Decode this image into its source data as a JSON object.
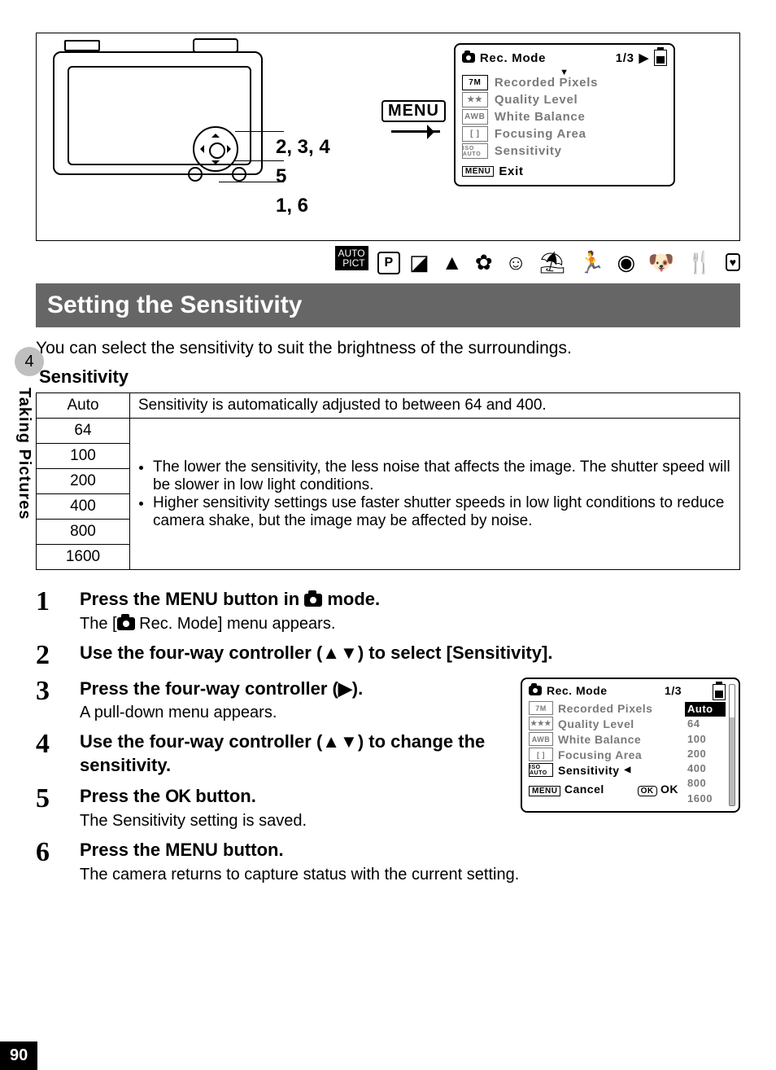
{
  "page_number": "90",
  "side_tab": {
    "chapter": "4",
    "label": "Taking Pictures"
  },
  "illus": {
    "callout1": "2, 3, 4",
    "callout2": "5",
    "callout3": "1, 6",
    "menu_btn": "MENU",
    "lcd": {
      "title": "Rec. Mode",
      "page": "1/3",
      "items": [
        {
          "icon": "7M",
          "label": "Recorded Pixels"
        },
        {
          "icon": "★★",
          "label": "Quality Level"
        },
        {
          "icon": "AWB",
          "label": "White Balance"
        },
        {
          "icon": "[ ]",
          "label": "Focusing Area"
        },
        {
          "icon": "ISO AUTO",
          "label": "Sensitivity"
        }
      ],
      "exit_btn": "MENU",
      "exit_label": "Exit"
    }
  },
  "heading": "Setting the Sensitivity",
  "intro": "You can select the sensitivity to suit the brightness of the surroundings.",
  "subhead": "Sensitivity",
  "table": {
    "auto_label": "Auto",
    "auto_desc": "Sensitivity is automatically adjusted to between 64 and 400.",
    "values": [
      "64",
      "100",
      "200",
      "400",
      "800",
      "1600"
    ],
    "bullets": [
      "The lower the sensitivity, the less noise that affects the image. The shutter speed will be slower in low light conditions.",
      "Higher sensitivity settings use faster shutter speeds in low light conditions to reduce camera shake, but the image may be affected by noise."
    ]
  },
  "steps": [
    {
      "n": "1",
      "title_pre": "Press the ",
      "title_btn": "MENU",
      "title_mid": " button in ",
      "title_post": " mode.",
      "desc_pre": "The [",
      "desc_post": " Rec. Mode] menu appears."
    },
    {
      "n": "2",
      "title": "Use the four-way controller (▲▼) to select [Sensitivity]."
    },
    {
      "n": "3",
      "title": "Press the four-way controller (▶).",
      "desc": "A pull-down menu appears."
    },
    {
      "n": "4",
      "title": "Use the four-way controller (▲▼) to change the sensitivity."
    },
    {
      "n": "5",
      "title_pre": "Press the ",
      "title_btn": "OK",
      "title_post": " button.",
      "desc": "The Sensitivity setting is saved."
    },
    {
      "n": "6",
      "title": "Press the MENU button.",
      "desc": "The camera returns to capture status with the current setting."
    }
  ],
  "lcd2": {
    "title": "Rec. Mode",
    "page": "1/3",
    "items": [
      {
        "icon": "7M",
        "label": "Recorded Pixels"
      },
      {
        "icon": "★★★",
        "label": "Quality Level"
      },
      {
        "icon": "AWB",
        "label": "White Balance"
      },
      {
        "icon": "[ ]",
        "label": "Focusing Area"
      },
      {
        "icon": "ISO AUTO",
        "label": "Sensitivity"
      }
    ],
    "options": [
      "Auto",
      "64",
      "100",
      "200",
      "400",
      "800",
      "1600"
    ],
    "selected": "Auto",
    "cancel_btn": "MENU",
    "cancel_label": "Cancel",
    "ok_btn": "OK",
    "ok_label": "OK"
  }
}
